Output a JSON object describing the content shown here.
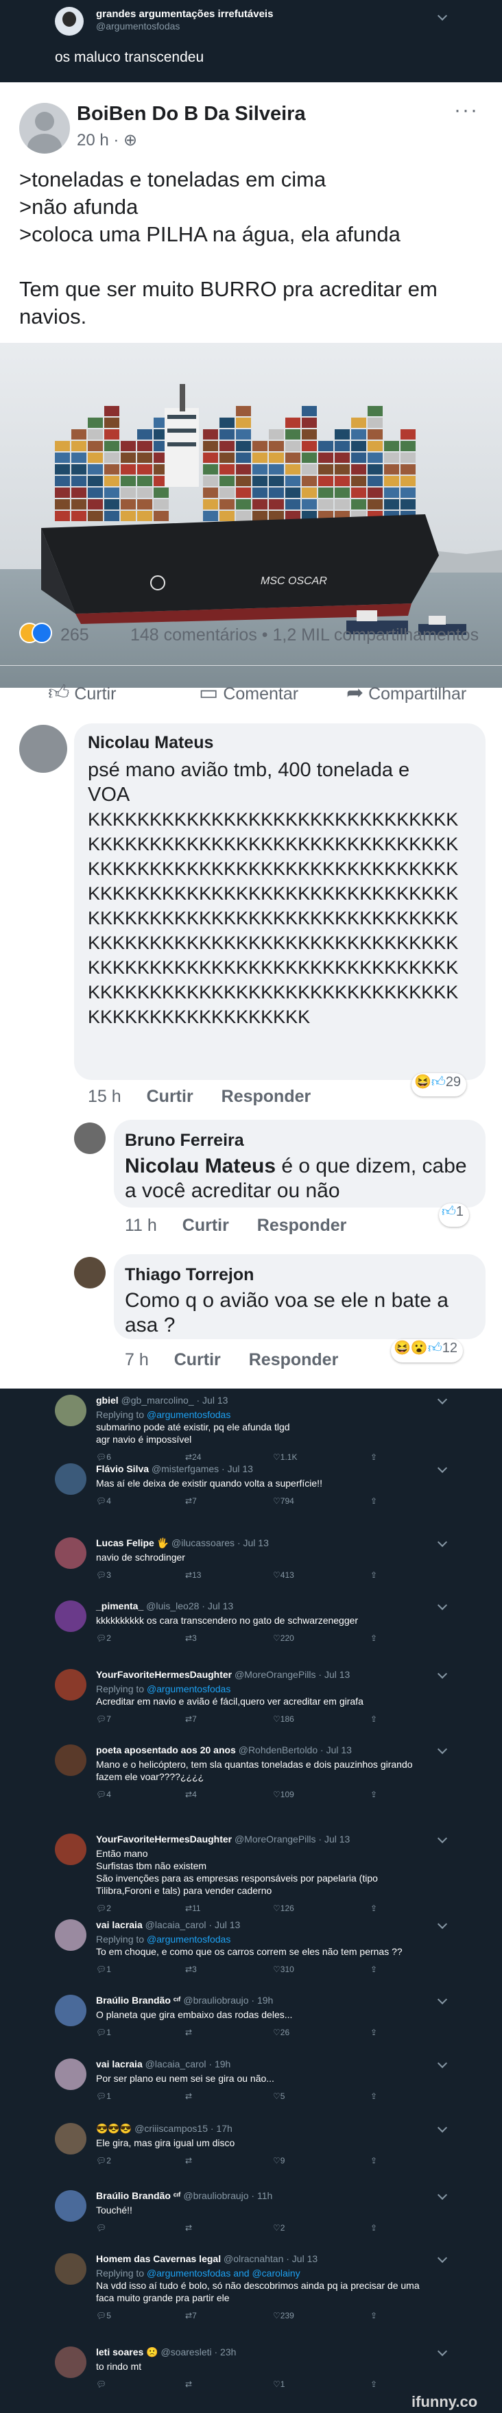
{
  "top_tweet": {
    "account_name": "grandes argumentações irrefutáveis",
    "handle": "@argumentosfodas",
    "text": "os maluco transcendeu"
  },
  "facebook_post": {
    "author": "BoiBen Do B Da Silveira",
    "time": "20 h",
    "more": "···",
    "lines": [
      ">toneladas e toneladas em cima",
      ">não afunda",
      ">coloca uma PILHA na água, ela afunda",
      "",
      "Tem que ser muito BURRO pra acreditar em navios."
    ],
    "ship_label": "MSC OSCAR",
    "reaction_count": "265",
    "stats": "148 comentários • 1,2 MIL compartilhamentos",
    "actions": {
      "like": "Curtir",
      "comment": "Comentar",
      "share": "Compartilhar"
    }
  },
  "fb_comments": [
    {
      "name": "Nicolau Mateus",
      "text_lines": [
        "psé mano avião tmb, 400 tonelada e",
        "VOA",
        "KKKKKKKKKKKKKKKKKKKKKKKKKKKKKK",
        "KKKKKKKKKKKKKKKKKKKKKKKKKKKKKK",
        "KKKKKKKKKKKKKKKKKKKKKKKKKKKKKK",
        "KKKKKKKKKKKKKKKKKKKKKKKKKKKKKK",
        "KKKKKKKKKKKKKKKKKKKKKKKKKKKKKK",
        "KKKKKKKKKKKKKKKKKKKKKKKKKKKKKK",
        "KKKKKKKKKKKKKKKKKKKKKKKKKKKKKK",
        "KKKKKKKKKKKKKKKKKKKKKKKKKKKKKK",
        "KKKKKKKKKKKKKKKKKK"
      ],
      "time": "15 h",
      "like": "Curtir",
      "reply": "Responder",
      "reactions": "29"
    },
    {
      "name": "Bruno Ferreira",
      "mention": "Nicolau Mateus",
      "text_lines": [
        " é o que dizem, cabe",
        "a você acreditar ou não"
      ],
      "time": "11 h",
      "like": "Curtir",
      "reply": "Responder",
      "reactions": "1"
    },
    {
      "name": "Thiago Torrejon",
      "text_lines": [
        "Como q o avião voa se ele n bate a",
        "asa ?"
      ],
      "time": "7 h",
      "like": "Curtir",
      "reply": "Responder",
      "reactions": "12"
    }
  ],
  "replies": [
    {
      "name": "gbiel",
      "handle": "@gb_marcolino_ · Jul 13",
      "replying_to": "@argumentosfodas",
      "lines": [
        "submarino pode até existir, pq ele afunda tlgd",
        "agr navio é impossível"
      ],
      "replies": "6",
      "retweets": "24",
      "likes": "1.1K",
      "avatar_color": "#7a8a6a"
    },
    {
      "name": "Flávio Silva",
      "handle": "@misterfgames · Jul 13",
      "replying_to": "",
      "lines": [
        "Mas aí ele deixa de existir quando volta a superfície!!"
      ],
      "replies": "4",
      "retweets": "7",
      "likes": "794",
      "avatar_color": "#3b5a7a"
    },
    {
      "name": "Lucas Felipe 🖐",
      "handle": "@ilucassoares · Jul 13",
      "replying_to": "",
      "lines": [
        "navio de schrodinger"
      ],
      "replies": "3",
      "retweets": "13",
      "likes": "413",
      "avatar_color": "#8a4a5a"
    },
    {
      "name": "_pimenta_",
      "handle": "@luis_leo28 · Jul 13",
      "replying_to": "",
      "lines": [
        "kkkkkkkkkk os cara transcendero no gato de schwarzenegger"
      ],
      "replies": "2",
      "retweets": "3",
      "likes": "220",
      "avatar_color": "#6a3a8a"
    },
    {
      "name": "YourFavoriteHermesDaughter",
      "handle": "@MoreOrangePills · Jul 13",
      "replying_to": "@argumentosfodas",
      "lines": [
        "Acreditar em navio e avião é fácil,quero ver acreditar em girafa"
      ],
      "replies": "7",
      "retweets": "7",
      "likes": "186",
      "avatar_color": "#8a3a2a"
    },
    {
      "name": "poeta aposentado aos 20 anos",
      "handle": "@RohdenBertoldo · Jul 13",
      "replying_to": "",
      "lines": [
        "Mano e o helicóptero, tem sla quantas toneladas e dois pauzinhos girando",
        "fazem ele voar????¿¿¿¿"
      ],
      "replies": "4",
      "retweets": "4",
      "likes": "109",
      "avatar_color": "#5a3a2a"
    },
    {
      "name": "YourFavoriteHermesDaughter",
      "handle": "@MoreOrangePills · Jul 13",
      "replying_to": "",
      "lines": [
        "Então mano",
        "Surfistas tbm não existem",
        "São invenções para as empresas responsáveis por papelaria (tipo",
        "Tilibra,Foroni e tals) para vender caderno"
      ],
      "replies": "2",
      "retweets": "11",
      "likes": "126",
      "avatar_color": "#8a3a2a"
    },
    {
      "name": "vai lacraia",
      "handle": "@lacaia_carol · Jul 13",
      "replying_to": "@argumentosfodas",
      "lines": [
        "To em choque, e como que os carros correm se eles não tem pernas ??"
      ],
      "replies": "1",
      "retweets": "3",
      "likes": "310",
      "avatar_color": "#9a8aa0"
    },
    {
      "name": "Braúlio Brandão ᶜᶦᶠ",
      "handle": "@brauliobraujo · 19h",
      "replying_to": "",
      "lines": [
        "O planeta que gira embaixo das rodas deles..."
      ],
      "replies": "1",
      "retweets": "",
      "likes": "26",
      "avatar_color": "#4a6a9a"
    },
    {
      "name": "vai lacraia",
      "handle": "@lacaia_carol · 19h",
      "replying_to": "",
      "lines": [
        "Por ser plano eu nem sei se gira ou não..."
      ],
      "replies": "1",
      "retweets": "",
      "likes": "5",
      "avatar_color": "#9a8aa0"
    },
    {
      "name": "😎😎😎",
      "handle": "@criiiscampos15 · 17h",
      "replying_to": "",
      "lines": [
        "Ele gira, mas gira igual um disco"
      ],
      "replies": "2",
      "retweets": "",
      "likes": "9",
      "avatar_color": "#6a5a4a"
    },
    {
      "name": "Braúlio Brandão ᶜᶦᶠ",
      "handle": "@brauliobraujo · 11h",
      "replying_to": "",
      "lines": [
        "Touché!!"
      ],
      "replies": "",
      "retweets": "",
      "likes": "2",
      "avatar_color": "#4a6a9a"
    },
    {
      "name": "Homem das Cavernas legal",
      "handle": "@olracnahtan · Jul 13",
      "replying_to": "@argumentosfodas and @carolainy",
      "lines": [
        "Na vdd isso aí tudo é bolo, só não descobrimos ainda pq ia precisar de uma",
        "faca muito grande pra partir ele"
      ],
      "replies": "5",
      "retweets": "7",
      "likes": "239",
      "avatar_color": "#5a4a3a"
    },
    {
      "name": "leti soares 🙁",
      "handle": "@soaresleti · 23h",
      "replying_to": "",
      "lines": [
        "to rindo mt"
      ],
      "replies": "",
      "retweets": "",
      "likes": "1",
      "avatar_color": "#6a4a4a"
    }
  ],
  "labels": {
    "replying_prefix": "Replying to "
  },
  "watermark": "ifunny.co",
  "colors": {
    "background": "#15202b",
    "muted": "#8899a6",
    "link": "#1da1f2",
    "facebook_blue": "#1877f2"
  }
}
